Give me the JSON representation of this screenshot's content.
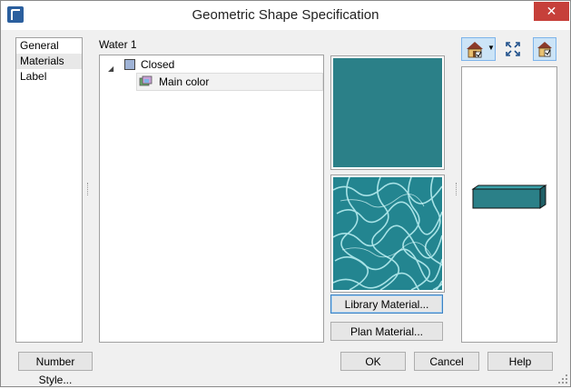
{
  "window": {
    "title": "Geometric Shape Specification",
    "close_glyph": "✕"
  },
  "nav": {
    "items": [
      "General",
      "Materials",
      "Label"
    ],
    "selected": "Materials"
  },
  "object": {
    "name": "Water 1"
  },
  "tree": {
    "expand_glyph": "◢",
    "root": {
      "label": "Closed",
      "icon": "box-icon"
    },
    "child": {
      "label": "Main color",
      "icon": "material-icon"
    }
  },
  "swatch": {
    "color": "#2b8088",
    "texture": "water-caustics-texture"
  },
  "buttons": {
    "library_material": "Library Material...",
    "plan_material": "Plan Material...",
    "number_style": "Number Style...",
    "ok": "OK",
    "cancel": "Cancel",
    "help": "Help"
  },
  "toolbar": {
    "view_icon": "house-view-icon",
    "fill_icon": "fill-window-icon",
    "toggle_icon": "house-check-icon"
  },
  "colors": {
    "accent": "#2b8088",
    "titlebar_close": "#c6403a"
  }
}
